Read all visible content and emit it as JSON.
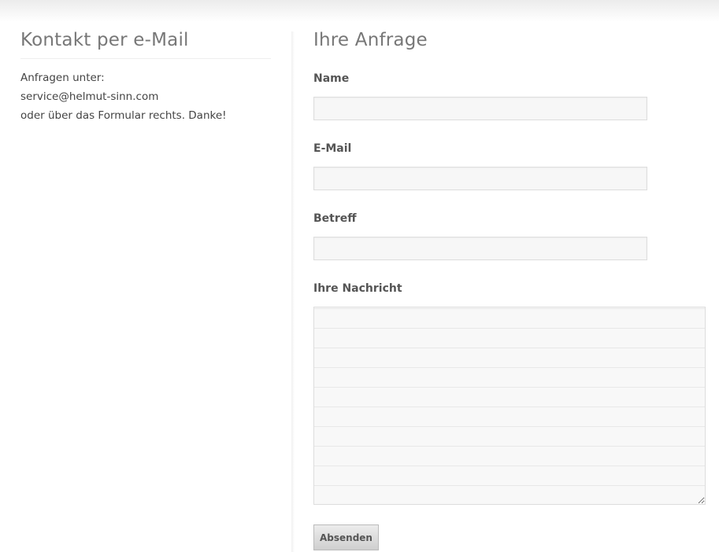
{
  "contact": {
    "title": "Kontakt per e-Mail",
    "lines": [
      "Anfragen unter:",
      "service@helmut-sinn.com",
      "oder über das Formular rechts. Danke!"
    ]
  },
  "form": {
    "title": "Ihre Anfrage",
    "name_label": "Name",
    "name_value": "",
    "email_label": "E-Mail",
    "email_value": "",
    "subject_label": "Betreff",
    "subject_value": "",
    "message_label": "Ihre Nachricht",
    "message_value": "",
    "submit_label": "Absenden"
  }
}
